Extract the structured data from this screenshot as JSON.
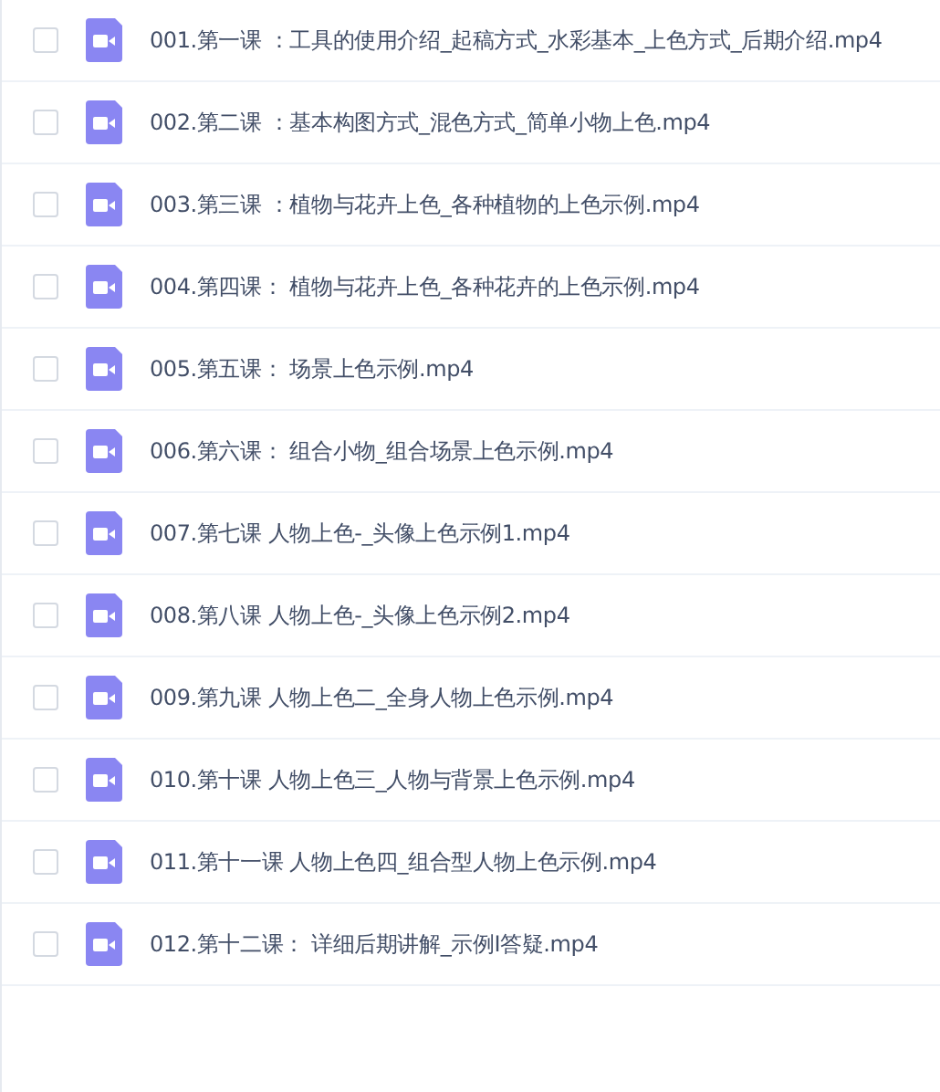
{
  "files": [
    {
      "name": "001.第一课 ：工具的使用介绍_起稿方式_水彩基本_上色方式_后期介绍.mp4",
      "checked": false
    },
    {
      "name": "002.第二课 ：基本构图方式_混色方式_简单小物上色.mp4",
      "checked": false
    },
    {
      "name": "003.第三课 ：植物与花卉上色_各种植物的上色示例.mp4",
      "checked": false
    },
    {
      "name": "004.第四课： 植物与花卉上色_各种花卉的上色示例.mp4",
      "checked": false
    },
    {
      "name": "005.第五课： 场景上色示例.mp4",
      "checked": false
    },
    {
      "name": "006.第六课： 组合小物_组合场景上色示例.mp4",
      "checked": false
    },
    {
      "name": "007.第七课 人物上色-_头像上色示例1.mp4",
      "checked": false
    },
    {
      "name": "008.第八课 人物上色-_头像上色示例2.mp4",
      "checked": false
    },
    {
      "name": "009.第九课 人物上色二_全身人物上色示例.mp4",
      "checked": false
    },
    {
      "name": "010.第十课 人物上色三_人物与背景上色示例.mp4",
      "checked": false
    },
    {
      "name": "011.第十一课 人物上色四_组合型人物上色示例.mp4",
      "checked": false
    },
    {
      "name": "012.第十二课： 详细后期讲解_示例I答疑.mp4",
      "checked": false
    }
  ]
}
